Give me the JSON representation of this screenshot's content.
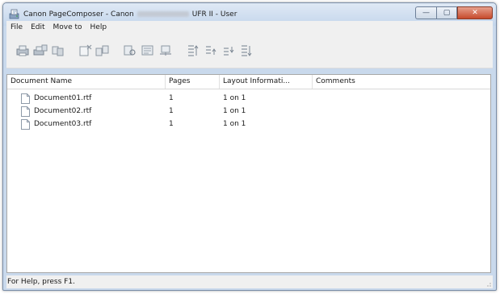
{
  "window": {
    "title_prefix": "Canon PageComposer - Canon",
    "title_suffix": "UFR II - User",
    "buttons": {
      "minimize": "—",
      "maximize": "▢",
      "close": "✕"
    }
  },
  "menu": [
    "File",
    "Edit",
    "Move to",
    "Help"
  ],
  "toolbar": [
    {
      "name": "print-icon"
    },
    {
      "name": "print-settings-icon"
    },
    {
      "name": "combine-icon"
    },
    {
      "name": "delete-icon"
    },
    {
      "name": "duplicate-icon"
    },
    {
      "name": "preview-icon"
    },
    {
      "name": "details-icon"
    },
    {
      "name": "print-layout-icon"
    },
    {
      "name": "move-to-top-icon"
    },
    {
      "name": "move-up-icon"
    },
    {
      "name": "move-down-icon"
    },
    {
      "name": "move-to-bottom-icon"
    }
  ],
  "list": {
    "columns": [
      "Document Name",
      "Pages",
      "Layout Informati...",
      "Comments"
    ],
    "rows": [
      [
        "Document01.rtf",
        "1",
        "1 on 1",
        ""
      ],
      [
        "Document02.rtf",
        "1",
        "1 on 1",
        ""
      ],
      [
        "Document03.rtf",
        "1",
        "1 on 1",
        ""
      ]
    ]
  },
  "status": "For Help, press F1.",
  "colors": {
    "close_button": "#c64a2c",
    "title_bar": "#c4d6ec"
  }
}
